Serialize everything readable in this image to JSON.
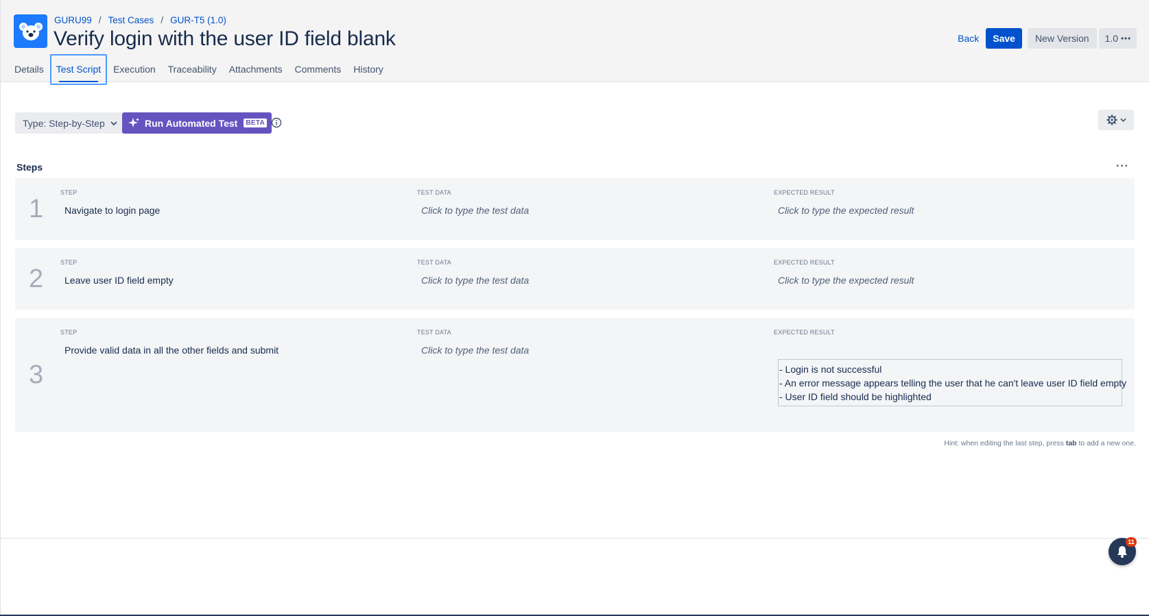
{
  "breadcrumb": {
    "project": "GURU99",
    "section": "Test Cases",
    "item": "GUR-T5 (1.0)",
    "separator": "/"
  },
  "page_title": "Verify login with the user ID field blank",
  "actions": {
    "back_label": "Back",
    "save_label": "Save",
    "new_version_label": "New Version",
    "version_label": "1.0"
  },
  "tabs": [
    {
      "label": "Details",
      "active": false
    },
    {
      "label": "Test Script",
      "active": true
    },
    {
      "label": "Execution",
      "active": false
    },
    {
      "label": "Traceability",
      "active": false
    },
    {
      "label": "Attachments",
      "active": false
    },
    {
      "label": "Comments",
      "active": false
    },
    {
      "label": "History",
      "active": false
    }
  ],
  "toolbar": {
    "type_label": "Type: Step-by-Step",
    "run_label": "Run Automated Test",
    "beta_label": "BETA"
  },
  "steps_section": {
    "title": "Steps",
    "more_label": "···"
  },
  "columns": {
    "step": "STEP",
    "test_data": "TEST DATA",
    "expected_result": "EXPECTED RESULT"
  },
  "steps": [
    {
      "number": "1",
      "step": "Navigate to login page",
      "test_data_placeholder": "Click to type the test data",
      "expected_placeholder": "Click to type the expected result"
    },
    {
      "number": "2",
      "step": "Leave user ID field empty",
      "test_data_placeholder": "Click to type the test data",
      "expected_placeholder": "Click to type the expected result"
    },
    {
      "number": "3",
      "step": "Provide valid data in all the other fields and submit",
      "test_data_placeholder": "Click to type the test data",
      "expected_lines": [
        "- Login is not successful",
        "- An error message appears telling the user that he can't leave user ID field empty",
        "- User ID field should be highlighted"
      ]
    }
  ],
  "hint": {
    "prefix": "Hint: when editing the last step, press",
    "key": "tab",
    "suffix": "to add a new one."
  },
  "notifications": {
    "count": "11"
  },
  "colors": {
    "primary": "#0052cc",
    "run_button": "#6554c0",
    "logo_bg": "#1d7afc",
    "badge": "#de350b"
  }
}
